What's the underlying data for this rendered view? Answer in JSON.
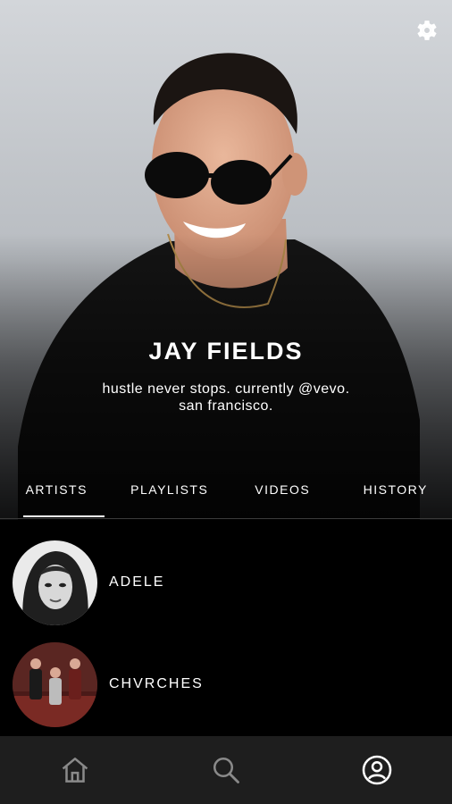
{
  "profile": {
    "name": "JAY FIELDS",
    "bio_line1": "hustle never stops. currently @vevo.",
    "bio_line2": "san francisco."
  },
  "tabs": [
    {
      "label": "ARTISTS",
      "active": true
    },
    {
      "label": "PLAYLISTS",
      "active": false
    },
    {
      "label": "VIDEOS",
      "active": false
    },
    {
      "label": "HISTORY",
      "active": false
    }
  ],
  "artists": [
    {
      "name": "ADELE"
    },
    {
      "name": "CHVRCHES"
    }
  ],
  "nav": {
    "home_icon": "home-icon",
    "search_icon": "search-icon",
    "profile_icon": "profile-icon",
    "active": "profile"
  },
  "colors": {
    "background": "#000000",
    "nav_background": "#1e1e1e",
    "nav_icon_inactive": "#8a8a8a",
    "nav_icon_active": "#ffffff"
  }
}
